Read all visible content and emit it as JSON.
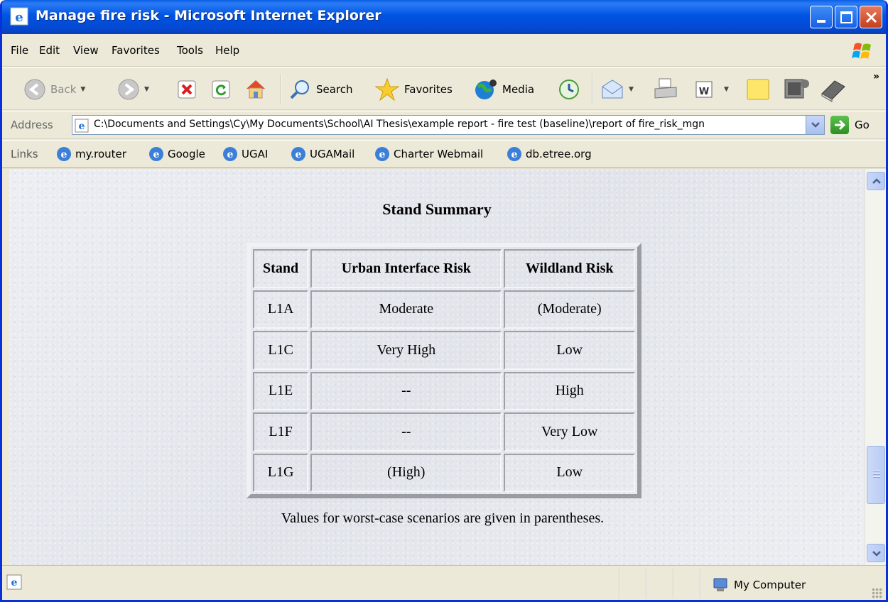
{
  "window": {
    "title": "Manage fire risk - Microsoft Internet Explorer"
  },
  "menu": {
    "file": "File",
    "edit": "Edit",
    "view": "View",
    "favorites": "Favorites",
    "tools": "Tools",
    "help": "Help"
  },
  "toolbar": {
    "back": "Back",
    "search": "Search",
    "favorites": "Favorites",
    "media": "Media"
  },
  "address": {
    "label": "Address",
    "url": "C:\\Documents and Settings\\Cy\\My Documents\\School\\AI Thesis\\example report - fire test (baseline)\\report of fire_risk_mgn",
    "go": "Go"
  },
  "links": {
    "label": "Links",
    "items": [
      "my.router",
      "Google",
      "UGAI",
      "UGAMail",
      "Charter Webmail",
      "db.etree.org"
    ]
  },
  "content": {
    "title": "Stand Summary",
    "table": {
      "headers": [
        "Stand",
        "Urban Interface Risk",
        "Wildland Risk"
      ],
      "rows": [
        [
          "L1A",
          "Moderate",
          "(Moderate)"
        ],
        [
          "L1C",
          "Very High",
          "Low"
        ],
        [
          "L1E",
          "--",
          "High"
        ],
        [
          "L1F",
          "--",
          "Very Low"
        ],
        [
          "L1G",
          "(High)",
          "Low"
        ]
      ]
    },
    "caption": "Values for worst-case scenarios are given in parentheses."
  },
  "status": {
    "zone": "My Computer"
  },
  "icons": {
    "title": "ie-icon",
    "back": "back-arrow-icon",
    "forward": "forward-arrow-icon",
    "stop": "stop-icon",
    "refresh": "refresh-icon",
    "home": "home-icon",
    "search": "search-icon",
    "favorites": "star-icon",
    "media": "media-icon",
    "history": "history-icon",
    "mail": "mail-icon",
    "print": "printer-icon",
    "edit": "word-icon",
    "discuss": "note-icon",
    "messenger": "messenger-icon",
    "research": "book-icon"
  }
}
